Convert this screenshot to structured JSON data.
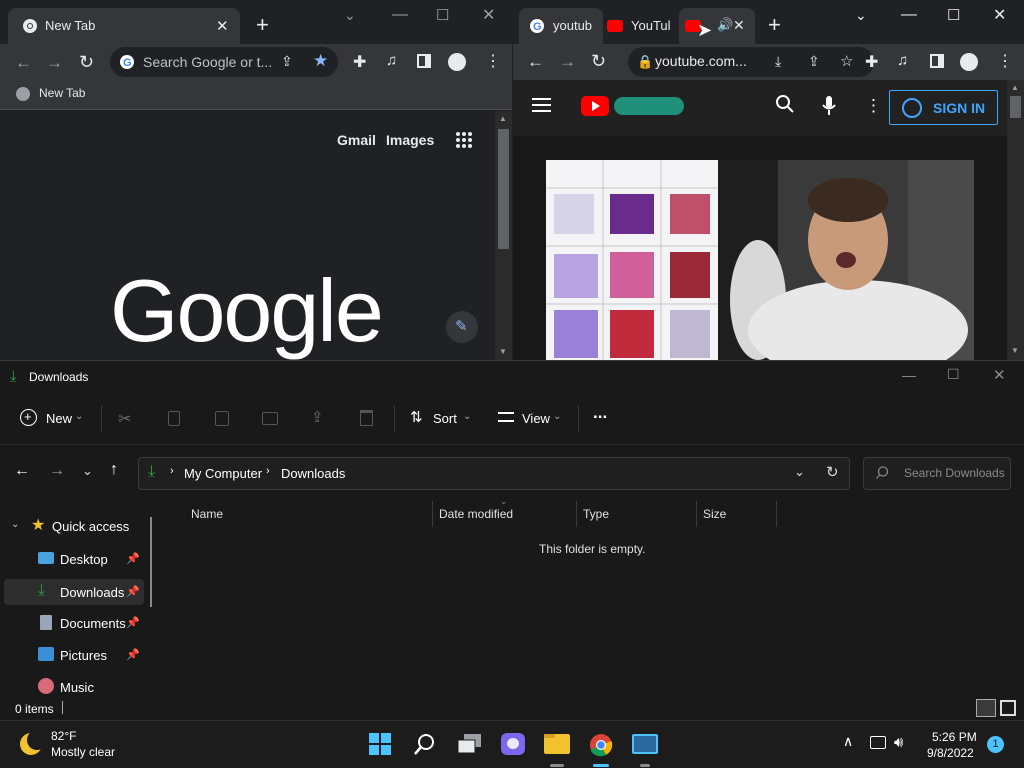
{
  "chrome_left": {
    "tab_title": "New Tab",
    "omnibox_placeholder": "Search Google or t...",
    "bookmark_label": "New Tab",
    "gmail_link": "Gmail",
    "images_link": "Images",
    "logo_text": "Google"
  },
  "chrome_right": {
    "tab1_title": "youtub",
    "tab2_title": "YouTul",
    "url": "youtube.com...",
    "sign_in_label": "SIGN IN",
    "brand_color": "#ff0000",
    "accent_color": "#3ea6ff"
  },
  "explorer": {
    "window_title": "Downloads",
    "toolbar": {
      "new_label": "New",
      "sort_label": "Sort",
      "view_label": "View",
      "more_label": "..."
    },
    "breadcrumb": {
      "root": "My Computer",
      "current": "Downloads"
    },
    "search_placeholder": "Search Downloads",
    "columns": [
      "Name",
      "Date modified",
      "Type",
      "Size"
    ],
    "empty_message": "This folder is empty.",
    "sidebar": [
      {
        "label": "Quick access",
        "icon": "star-icon"
      },
      {
        "label": "Desktop",
        "icon": "desktop-icon",
        "pinned": true
      },
      {
        "label": "Downloads",
        "icon": "download-icon",
        "pinned": true,
        "selected": true
      },
      {
        "label": "Documents",
        "icon": "document-icon",
        "pinned": true
      },
      {
        "label": "Pictures",
        "icon": "pictures-icon",
        "pinned": true
      },
      {
        "label": "Music",
        "icon": "music-icon"
      }
    ],
    "status": "0 items"
  },
  "taskbar": {
    "weather_temp": "82°F",
    "weather_desc": "Mostly clear",
    "time": "5:26 PM",
    "date": "9/8/2022",
    "notification_count": "1"
  }
}
